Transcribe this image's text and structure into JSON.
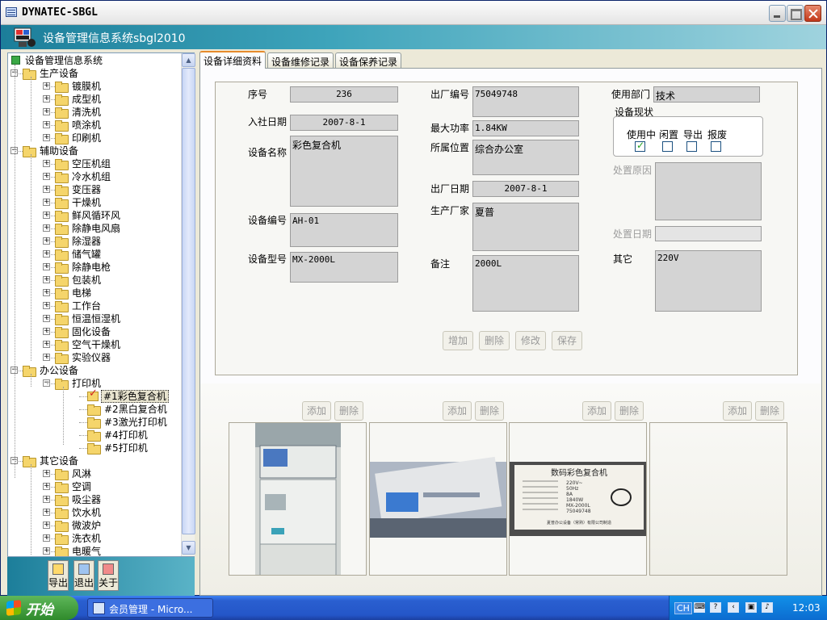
{
  "window": {
    "title": "DYNATEC-SBGL"
  },
  "banner": {
    "system_name": "设备管理信息系统sbgl2010"
  },
  "tree": {
    "root": "设备管理信息系统",
    "groups": [
      {
        "label": "生产设备",
        "items": [
          "镀膜机",
          "成型机",
          "清洗机",
          "喷涂机",
          "印刷机"
        ]
      },
      {
        "label": "辅助设备",
        "items": [
          "空压机组",
          "冷水机组",
          "变压器",
          "干燥机",
          "鲜风循环风",
          "除静电风扇",
          "除湿器",
          "储气罐",
          "除静电枪",
          "包装机",
          "电梯",
          "工作台",
          "恒温恒湿机",
          "固化设备",
          "空气干燥机",
          "实验仪器"
        ]
      },
      {
        "label": "办公设备",
        "sub": "打印机",
        "leaves": [
          "#1彩色复合机",
          "#2黑白复合机",
          "#3激光打印机",
          "#4打印机",
          "#5打印机"
        ]
      },
      {
        "label": "其它设备",
        "items": [
          "风淋",
          "空调",
          "吸尘器",
          "饮水机",
          "微波炉",
          "洗衣机",
          "电暖气"
        ]
      }
    ]
  },
  "bottom_buttons": {
    "export": "导出",
    "exit": "退出",
    "about": "关于"
  },
  "tabs": [
    "设备详细资料",
    "设备维修记录",
    "设备保养记录"
  ],
  "form": {
    "labels": {
      "seq": "序号",
      "join_date": "入社日期",
      "name": "设备名称",
      "code": "设备编号",
      "model": "设备型号",
      "factory_no": "出厂编号",
      "max_power": "最大功率",
      "location": "所属位置",
      "factory_date": "出厂日期",
      "manufacturer": "生产厂家",
      "remark": "备注",
      "dept": "使用部门",
      "status": "设备现状",
      "dispose_reason": "处置原因",
      "dispose_date": "处置日期",
      "other": "其它"
    },
    "values": {
      "seq": "236",
      "join_date": "2007-8-1",
      "name": "彩色复合机",
      "code": "AH-01",
      "model": "MX-2000L",
      "factory_no": "75049748",
      "max_power": "1.84KW",
      "location": "综合办公室",
      "factory_date": "2007-8-1",
      "manufacturer": "夏普",
      "remark": "2000L",
      "dept": "技术",
      "dispose_reason": "",
      "dispose_date": "",
      "other": "220V"
    },
    "status_options": [
      {
        "label": "使用中",
        "checked": true
      },
      {
        "label": "闲置",
        "checked": false
      },
      {
        "label": "导出",
        "checked": false
      },
      {
        "label": "报废",
        "checked": false
      }
    ],
    "buttons": {
      "add": "增加",
      "delete": "删除",
      "edit": "修改",
      "save": "保存"
    }
  },
  "photos": {
    "add_label": "添加",
    "delete_label": "删除",
    "plate": {
      "heading": "数码彩色复合机",
      "rows": [
        "220V~",
        "50Hz",
        "8A",
        "1840W",
        "MX-2000L",
        "75049748"
      ],
      "footer": "夏普办公设备（常熟）有限公司制造"
    }
  },
  "taskbar": {
    "start": "开始",
    "task": "会员管理 - Micro...",
    "lang": "CH",
    "clock": "12:03"
  }
}
